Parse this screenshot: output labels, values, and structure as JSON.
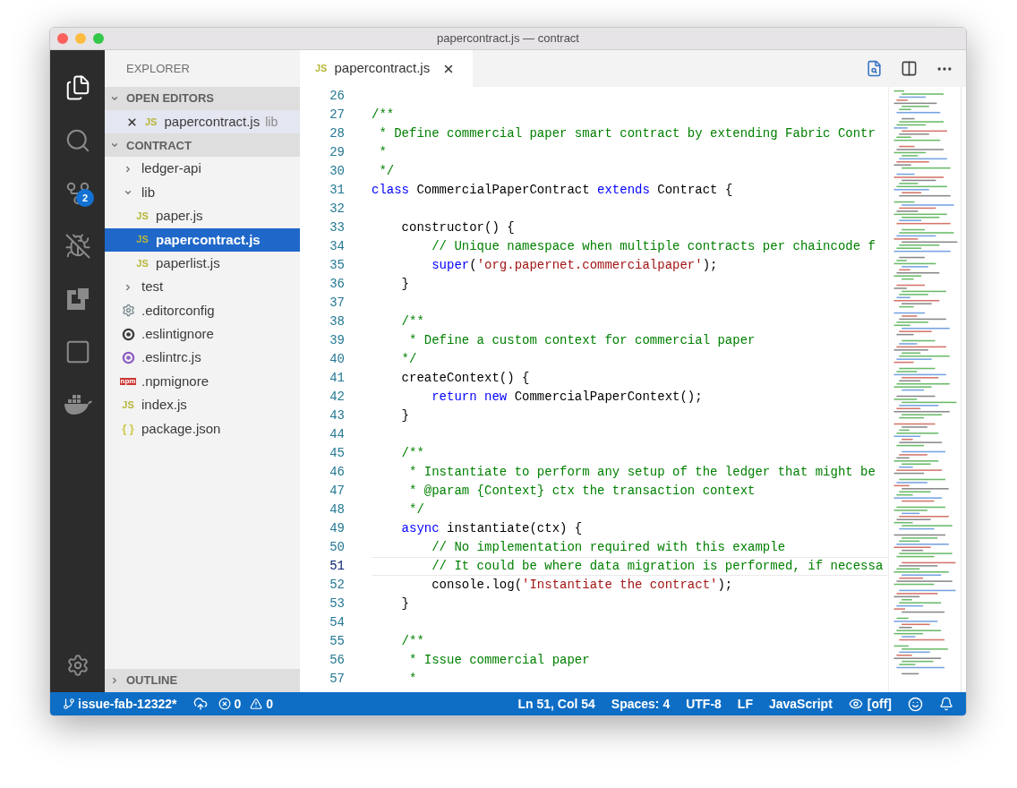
{
  "window": {
    "title": "papercontract.js — contract"
  },
  "activity_bar": [
    {
      "kind": "files",
      "selected": true
    },
    {
      "kind": "search",
      "selected": false
    },
    {
      "kind": "source-control",
      "selected": false,
      "badge": "2"
    },
    {
      "kind": "debug",
      "selected": false
    },
    {
      "kind": "extensions",
      "selected": false
    },
    {
      "kind": "square",
      "selected": false
    },
    {
      "kind": "docker",
      "selected": false
    }
  ],
  "sidebar": {
    "title": "EXPLORER",
    "open_editors": {
      "title": "OPEN EDITORS",
      "expanded": true,
      "items": [
        {
          "kind": "js",
          "name": "papercontract.js",
          "icon_text": "JS",
          "description": "lib",
          "selected": true
        }
      ]
    },
    "folder": {
      "title": "CONTRACT",
      "expanded": true,
      "items": [
        {
          "kind": "folder",
          "name": "ledger-api",
          "expanded": false,
          "selected": false
        },
        {
          "kind": "folder",
          "name": "lib",
          "expanded": true,
          "selected": false,
          "children": [
            {
              "kind": "js",
              "name": "paper.js",
              "icon_text": "JS",
              "selected": false
            },
            {
              "kind": "js",
              "name": "papercontract.js",
              "icon_text": "JS",
              "selected": true
            },
            {
              "kind": "js",
              "name": "paperlist.js",
              "icon_text": "JS",
              "selected": false
            }
          ]
        },
        {
          "kind": "folder",
          "name": "test",
          "expanded": false,
          "selected": false
        },
        {
          "kind": "config",
          "name": ".editorconfig",
          "selected": false
        },
        {
          "kind": "ignore",
          "name": ".eslintignore",
          "selected": false
        },
        {
          "kind": "eslint",
          "name": ".eslintrc.js",
          "selected": false
        },
        {
          "kind": "npm",
          "name": ".npmignore",
          "icon_text": "npm",
          "selected": false
        },
        {
          "kind": "js",
          "name": "index.js",
          "icon_text": "JS",
          "selected": false
        },
        {
          "kind": "json",
          "name": "package.json",
          "icon_text": "{ }",
          "selected": false
        }
      ]
    },
    "outline": {
      "title": "OUTLINE",
      "expanded": false
    }
  },
  "editor": {
    "tabs": [
      {
        "label": "papercontract.js",
        "icon_text": "JS",
        "selected": true
      }
    ],
    "lines": [
      {
        "number": "26",
        "current": false
      },
      {
        "number": "27",
        "current": false,
        "tokens": [
          {
            "kind": "comment",
            "text": "/**"
          }
        ]
      },
      {
        "number": "28",
        "current": false,
        "tokens": [
          {
            "kind": "comment",
            "text": " * Define commercial paper smart contract by extending Fabric Contr"
          }
        ]
      },
      {
        "number": "29",
        "current": false,
        "tokens": [
          {
            "kind": "comment",
            "text": " *"
          }
        ]
      },
      {
        "number": "30",
        "current": false,
        "tokens": [
          {
            "kind": "comment",
            "text": " */"
          }
        ]
      },
      {
        "number": "31",
        "current": false,
        "tokens": [
          {
            "kind": "keyword",
            "text": "class"
          },
          {
            "kind": "plain",
            "text": " CommercialPaperContract "
          },
          {
            "kind": "keyword",
            "text": "extends"
          },
          {
            "kind": "plain",
            "text": " Contract {"
          }
        ]
      },
      {
        "number": "32",
        "current": false
      },
      {
        "number": "33",
        "current": false,
        "tokens": [
          {
            "kind": "plain",
            "text": "    constructor() {"
          }
        ]
      },
      {
        "number": "34",
        "current": false,
        "tokens": [
          {
            "kind": "comment",
            "text": "        // Unique namespace when multiple contracts per chaincode f"
          }
        ]
      },
      {
        "number": "35",
        "current": false,
        "tokens": [
          {
            "kind": "keyword",
            "text": "        super"
          },
          {
            "kind": "plain",
            "text": "("
          },
          {
            "kind": "string",
            "text": "'org.papernet.commercialpaper'"
          },
          {
            "kind": "plain",
            "text": ");"
          }
        ]
      },
      {
        "number": "36",
        "current": false,
        "tokens": [
          {
            "kind": "plain",
            "text": "    }"
          }
        ]
      },
      {
        "number": "37",
        "current": false
      },
      {
        "number": "38",
        "current": false,
        "tokens": [
          {
            "kind": "comment",
            "text": "    /**"
          }
        ]
      },
      {
        "number": "39",
        "current": false,
        "tokens": [
          {
            "kind": "comment",
            "text": "     * Define a custom context for commercial paper"
          }
        ]
      },
      {
        "number": "40",
        "current": false,
        "tokens": [
          {
            "kind": "comment",
            "text": "    */"
          }
        ]
      },
      {
        "number": "41",
        "current": false,
        "tokens": [
          {
            "kind": "plain",
            "text": "    createContext() {"
          }
        ]
      },
      {
        "number": "42",
        "current": false,
        "tokens": [
          {
            "kind": "keyword",
            "text": "        return new"
          },
          {
            "kind": "plain",
            "text": " CommercialPaperContext();"
          }
        ]
      },
      {
        "number": "43",
        "current": false,
        "tokens": [
          {
            "kind": "plain",
            "text": "    }"
          }
        ]
      },
      {
        "number": "44",
        "current": false
      },
      {
        "number": "45",
        "current": false,
        "tokens": [
          {
            "kind": "comment",
            "text": "    /**"
          }
        ]
      },
      {
        "number": "46",
        "current": false,
        "tokens": [
          {
            "kind": "comment",
            "text": "     * Instantiate to perform any setup of the ledger that might be"
          }
        ]
      },
      {
        "number": "47",
        "current": false,
        "tokens": [
          {
            "kind": "comment",
            "text": "     * @param {Context} ctx the transaction context"
          }
        ]
      },
      {
        "number": "48",
        "current": false,
        "tokens": [
          {
            "kind": "comment",
            "text": "     */"
          }
        ]
      },
      {
        "number": "49",
        "current": false,
        "tokens": [
          {
            "kind": "keyword",
            "text": "    async"
          },
          {
            "kind": "plain",
            "text": " instantiate(ctx) {"
          }
        ]
      },
      {
        "number": "50",
        "current": false,
        "tokens": [
          {
            "kind": "comment",
            "text": "        // No implementation required with this example"
          }
        ]
      },
      {
        "number": "51",
        "current": true,
        "tokens": [
          {
            "kind": "comment",
            "text": "        // It could be where data migration is performed, if necessa"
          }
        ]
      },
      {
        "number": "52",
        "current": false,
        "tokens": [
          {
            "kind": "plain",
            "text": "        console.log("
          },
          {
            "kind": "string",
            "text": "'Instantiate the contract'"
          },
          {
            "kind": "plain",
            "text": ");"
          }
        ]
      },
      {
        "number": "53",
        "current": false,
        "tokens": [
          {
            "kind": "plain",
            "text": "    }"
          }
        ]
      },
      {
        "number": "54",
        "current": false
      },
      {
        "number": "55",
        "current": false,
        "tokens": [
          {
            "kind": "comment",
            "text": "    /**"
          }
        ]
      },
      {
        "number": "56",
        "current": false,
        "tokens": [
          {
            "kind": "comment",
            "text": "     * Issue commercial paper"
          }
        ]
      },
      {
        "number": "57",
        "current": false,
        "tokens": [
          {
            "kind": "comment",
            "text": "     *"
          }
        ]
      }
    ]
  },
  "status_bar": {
    "branch": "issue-fab-12322*",
    "errors": "0",
    "warnings": "0",
    "items": [
      "Ln 51, Col 54",
      "Spaces: 4",
      "UTF-8",
      "LF",
      "JavaScript"
    ],
    "live_share": "[off]"
  }
}
